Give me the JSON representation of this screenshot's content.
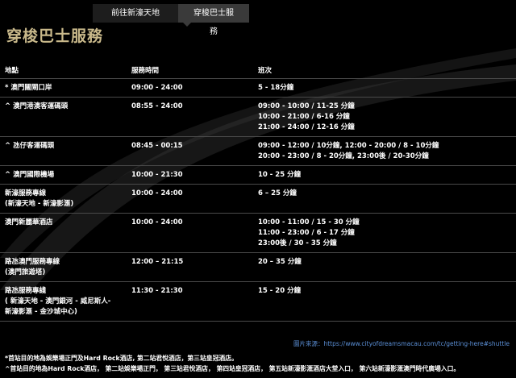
{
  "tabs": [
    {
      "label": "前往新濠天地"
    },
    {
      "label": "穿梭巴士服務"
    }
  ],
  "page_title": "穿梭巴士服務",
  "table": {
    "headers": [
      "地點",
      "服務時間",
      "班次"
    ],
    "rows": [
      {
        "location": [
          "* 澳門關閘口岸"
        ],
        "hours": "09:00 - 24:00",
        "frequency": [
          "5 - 18分鐘"
        ]
      },
      {
        "location": [
          "^ 澳門港澳客運碼頭"
        ],
        "hours": "08:55 - 24:00",
        "frequency": [
          "09:00 - 10:00 / 11-25 分鐘",
          "10:00 - 21:00 / 6-16 分鐘",
          "21:00 - 24:00 / 12-16 分鐘"
        ]
      },
      {
        "location": [
          "^ 氹仔客運碼頭"
        ],
        "hours": "08:45 - 00:15",
        "frequency": [
          "09:00 - 12:00 / 10分鐘, 12:00 - 20:00 / 8 - 10分鐘",
          "20:00 - 23:00 / 8 - 20分鐘, 23:00後 / 20-30分鐘"
        ]
      },
      {
        "location": [
          "^ 澳門國際機場"
        ],
        "hours": "10:00 - 21:30",
        "frequency": [
          "10 - 25 分鐘"
        ]
      },
      {
        "location": [
          "新濠服務專線",
          "(新濠天地 - 新濠影滙)"
        ],
        "hours": "10:00 - 24:00",
        "frequency": [
          "6 – 25 分鐘"
        ]
      },
      {
        "location": [
          "澳門新麗華酒店"
        ],
        "hours": "10:00 - 24:00",
        "frequency": [
          "10:00 - 11:00 / 15 - 30 分鐘",
          "11:00 - 23:00 / 6 - 17 分鐘",
          "23:00後 / 30 - 35 分鐘"
        ]
      },
      {
        "location": [
          "路氹澳門服務專線",
          "(澳門旅遊塔)"
        ],
        "hours": "12:00 – 21:15",
        "frequency": [
          "20 – 35 分鐘"
        ]
      },
      {
        "location": [
          "路氹服務專綫",
          "( 新濠天地 - 澳門銀河 - 威尼斯人-",
          "新濠影滙 - 金沙城中心)"
        ],
        "hours": "11:30 - 21:30",
        "frequency": [
          "15 - 20 分鐘"
        ]
      }
    ]
  },
  "source": {
    "label": "圖片來源：",
    "url": "https://www.cityofdreamsmacau.com/tc/getting-here#shuttle"
  },
  "notes": [
    "*首站目的地為娛樂場正門及Hard Rock酒店, 第二站君悅酒店，第三站皇冠酒店。",
    "^首站目的地為Hard Rock酒店， 第二站娛樂場正門， 第三站君悅酒店， 第四站皇冠酒店， 第五站新濠影滙酒店大堂入口， 第六站新濠影滙澳門時代廣場入口。"
  ],
  "colors": {
    "background": "#000000",
    "title": "#c8b88a",
    "active_tab": "#3a3a3a",
    "inactive_tab": "#1d1d1d",
    "source_link": "#5b8fd6"
  }
}
